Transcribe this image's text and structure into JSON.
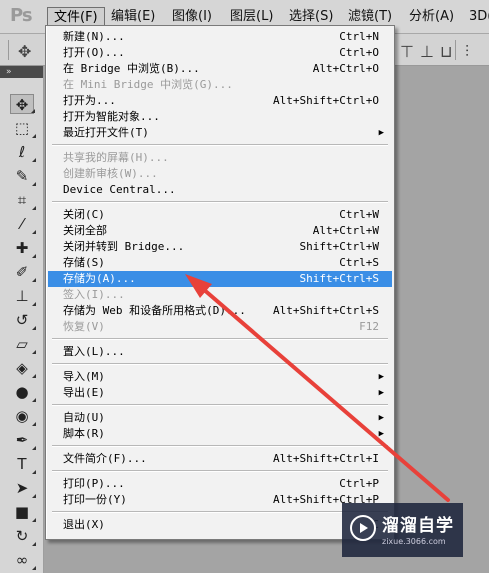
{
  "app": {
    "logo": "Ps"
  },
  "menubar": [
    {
      "label": "文件(F)",
      "active": true
    },
    {
      "label": "编辑(E)"
    },
    {
      "label": "图像(I)"
    },
    {
      "label": "图层(L)"
    },
    {
      "label": "选择(S)"
    },
    {
      "label": "滤镜(T)"
    },
    {
      "label": "分析(A)"
    },
    {
      "label": "3D("
    }
  ],
  "toolbox": {
    "collapse_label": "»"
  },
  "file_menu": {
    "items": [
      {
        "label": "新建(N)...",
        "shortcut": "Ctrl+N"
      },
      {
        "label": "打开(O)...",
        "shortcut": "Ctrl+O"
      },
      {
        "label": "在 Bridge 中浏览(B)...",
        "shortcut": "Alt+Ctrl+O"
      },
      {
        "label": "在 Mini Bridge 中浏览(G)...",
        "shortcut": "",
        "disabled": true
      },
      {
        "label": "打开为...",
        "shortcut": "Alt+Shift+Ctrl+O"
      },
      {
        "label": "打开为智能对象...",
        "shortcut": ""
      },
      {
        "label": "最近打开文件(T)",
        "shortcut": "",
        "submenu": true
      },
      {
        "label": "共享我的屏幕(H)...",
        "shortcut": "",
        "disabled": true
      },
      {
        "label": "创建新审核(W)...",
        "shortcut": "",
        "disabled": true
      },
      {
        "label": "Device Central...",
        "shortcut": ""
      },
      {
        "label": "关闭(C)",
        "shortcut": "Ctrl+W"
      },
      {
        "label": "关闭全部",
        "shortcut": "Alt+Ctrl+W"
      },
      {
        "label": "关闭并转到 Bridge...",
        "shortcut": "Shift+Ctrl+W"
      },
      {
        "label": "存储(S)",
        "shortcut": "Ctrl+S"
      },
      {
        "label": "存储为(A)...",
        "shortcut": "Shift+Ctrl+S",
        "highlighted": true
      },
      {
        "label": "签入(I)...",
        "shortcut": "",
        "disabled": true
      },
      {
        "label": "存储为 Web 和设备所用格式(D)...",
        "shortcut": "Alt+Shift+Ctrl+S"
      },
      {
        "label": "恢复(V)",
        "shortcut": "F12",
        "disabled": true
      },
      {
        "label": "置入(L)...",
        "shortcut": ""
      },
      {
        "label": "导入(M)",
        "shortcut": "",
        "submenu": true
      },
      {
        "label": "导出(E)",
        "shortcut": "",
        "submenu": true
      },
      {
        "label": "自动(U)",
        "shortcut": "",
        "submenu": true
      },
      {
        "label": "脚本(R)",
        "shortcut": "",
        "submenu": true
      },
      {
        "label": "文件简介(F)...",
        "shortcut": "Alt+Shift+Ctrl+I"
      },
      {
        "label": "打印(P)...",
        "shortcut": "Ctrl+P"
      },
      {
        "label": "打印一份(Y)",
        "shortcut": "Alt+Shift+Ctrl+P"
      },
      {
        "label": "退出(X)",
        "shortcut": "C"
      }
    ]
  },
  "watermark": {
    "title": "溜溜自学",
    "url": "zixue.3066.com"
  },
  "colors": {
    "highlight": "#3a8ee6",
    "arrow": "#e8413a"
  }
}
